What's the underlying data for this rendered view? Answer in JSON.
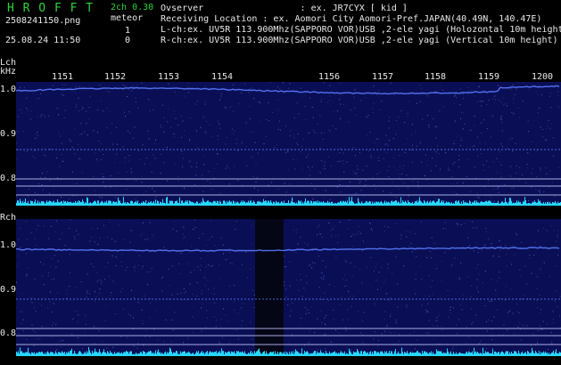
{
  "header": {
    "logo": "H R O F F T",
    "channel_label": "2ch 0.30",
    "filename": "2508241150.png",
    "meteor_label": "meteor",
    "meteor_count_l": "1",
    "meteor_count_r": "0",
    "datetime": "25.08.24 11:50",
    "observer": "Ovserver                  : ex. JR7CYX [ kid ]",
    "location": "Receiving Location : ex. Aomori City Aomori-Pref.JAPAN(40.49N, 140.47E)",
    "lch_info": "L-ch:ex. UV5R 113.900Mhz(SAPPORO VOR)USB ,2-ele yagi (Holozontal 10m height",
    "rch_info": "R-ch:ex. UV5R 113.900Mhz(SAPPORO VOR)USB ,2-ele yagi (Vertical 10m height)"
  },
  "time_labels": [
    "1151",
    "1152",
    "1153",
    "1154",
    "1156",
    "1157",
    "1158",
    "1159",
    "1200"
  ],
  "lch": {
    "channel": "Lch",
    "unit": "kHz",
    "y_ticks": [
      "1.0",
      "0.9",
      "0.8"
    ]
  },
  "rch": {
    "channel": "Rch",
    "y_ticks": [
      "1.0",
      "0.9",
      "0.8"
    ]
  },
  "colors": {
    "background": "#000000",
    "spectrum_bg": "#0a0f55",
    "trace": "#5a7cff",
    "floor": "#27d8ff",
    "guide": "#c8c8ff",
    "header_green": "#2fd23a"
  }
}
